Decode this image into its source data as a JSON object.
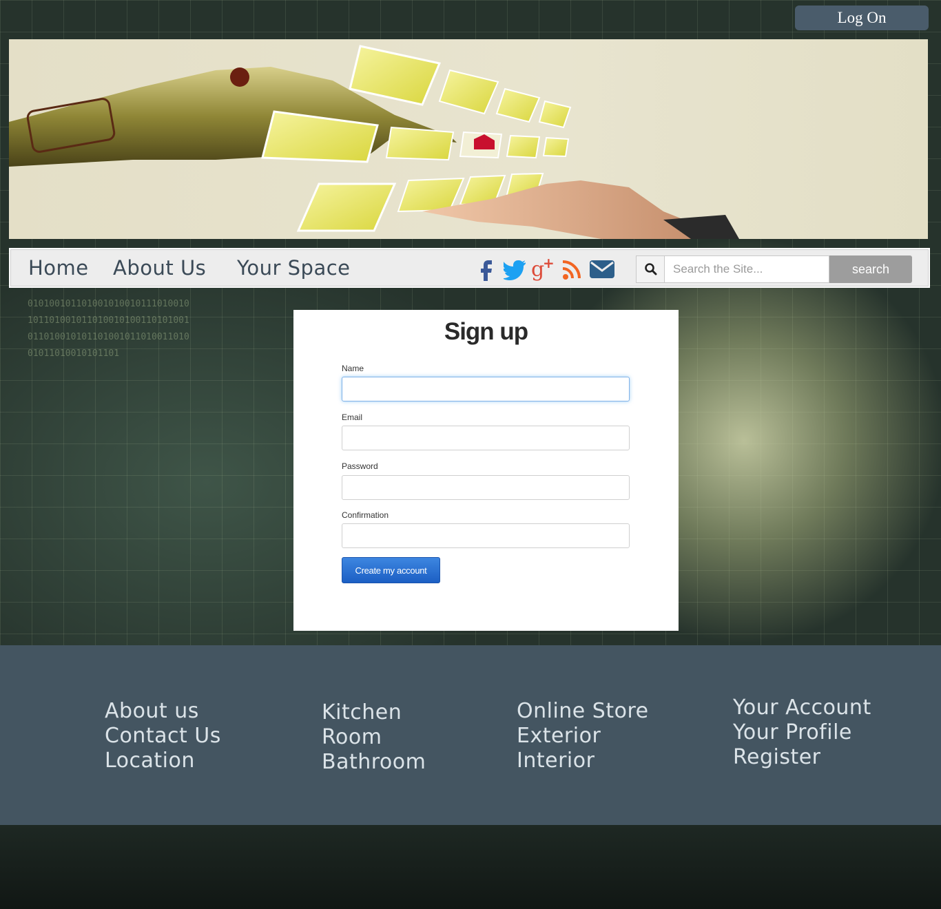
{
  "header": {
    "logon_label": "Log On"
  },
  "nav": {
    "links": [
      "Home",
      "About Us",
      "Your Space"
    ]
  },
  "social": {
    "icons": [
      "facebook-icon",
      "twitter-icon",
      "google-plus-icon",
      "rss-icon",
      "envelope-icon"
    ],
    "colors": {
      "facebook": "#3b5998",
      "twitter": "#1da1f2",
      "google_plus": "#dd4b39",
      "rss": "#f26522",
      "envelope": "#2d5f8a"
    }
  },
  "search": {
    "placeholder": "Search the Site...",
    "button_label": "search"
  },
  "signup": {
    "title": "Sign up",
    "fields": {
      "name_label": "Name",
      "email_label": "Email",
      "password_label": "Password",
      "confirmation_label": "Confirmation"
    },
    "submit_label": "Create my account"
  },
  "footer": {
    "columns": [
      [
        "About us",
        "Contact Us",
        "Location"
      ],
      [
        "Kitchen",
        "Room",
        "Bathroom"
      ],
      [
        "Online Store",
        "Exterior",
        "Interior"
      ],
      [
        "Your Account",
        "Your Profile",
        "Register"
      ]
    ]
  },
  "colors": {
    "footer_bg": "#445561",
    "logon_bg": "#4a5c6b",
    "create_button": "#1c5fc4"
  }
}
